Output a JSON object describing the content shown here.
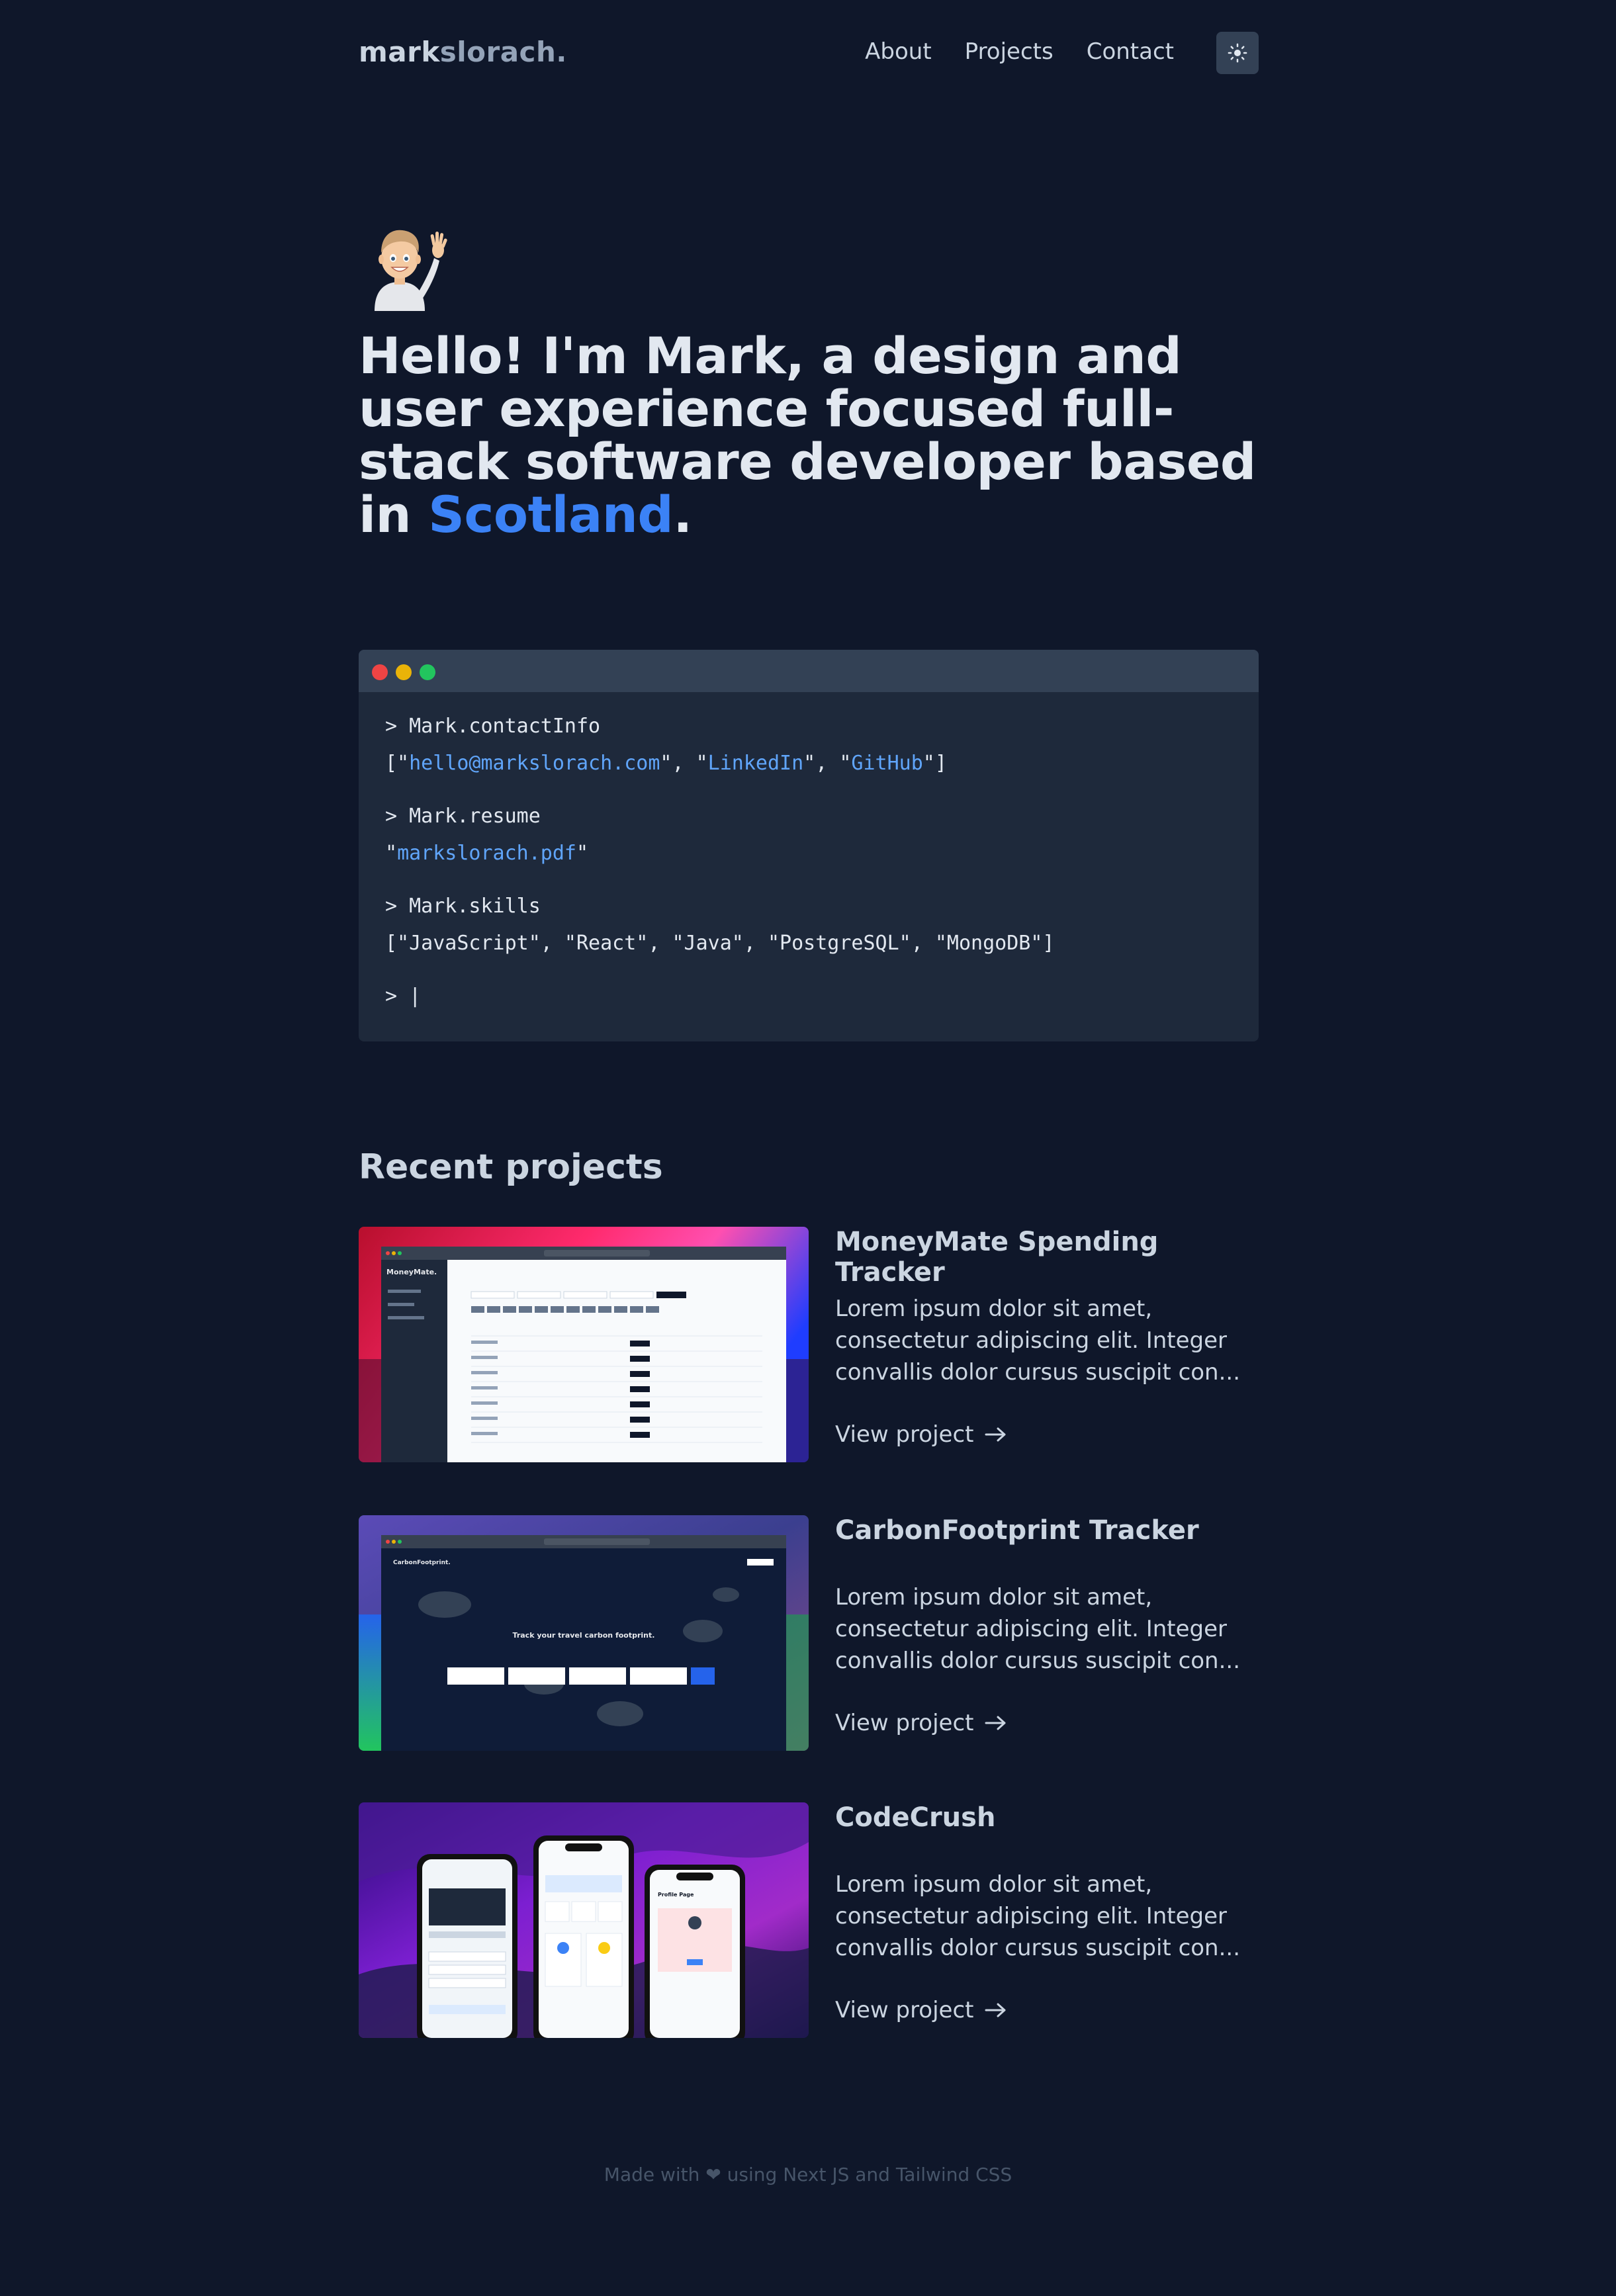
{
  "header": {
    "logo_part1": "mark",
    "logo_part2": "slorach.",
    "nav": [
      "About",
      "Projects",
      "Contact"
    ],
    "theme_icon": "sun-icon"
  },
  "hero": {
    "text_before": "Hello! I'm Mark, a design and user experience focused full-stack software developer based in ",
    "highlight": "Scotland",
    "text_after": ".",
    "avatar_icon": "memoji-waving-avatar"
  },
  "terminal": {
    "cmd1": "> Mark.contactInfo",
    "contact": {
      "email": "hello@markslorach.com",
      "linkedin": "LinkedIn",
      "github": "GitHub"
    },
    "cmd2": "> Mark.resume",
    "resume_file": "markslorach.pdf",
    "cmd3": "> Mark.skills",
    "skills_line": "[\"JavaScript\", \"React\", \"Java\", \"PostgreSQL\", \"MongoDB\"]",
    "prompt": "> |"
  },
  "projects_section": {
    "title": "Recent projects",
    "items": [
      {
        "title": "MoneyMate Spending Tracker",
        "desc": "Lorem ipsum dolor sit amet, consectetur adipiscing elit. Integer convallis dolor cursus suscipit con...",
        "link": "View project",
        "thumb_app": "MoneyMate."
      },
      {
        "title": "CarbonFootprint Tracker",
        "desc": "Lorem ipsum dolor sit amet, consectetur adipiscing elit. Integer convallis dolor cursus suscipit con...",
        "link": "View project",
        "thumb_app": "CarbonFootprint.",
        "thumb_heading": "Track your travel carbon footprint."
      },
      {
        "title": "CodeCrush",
        "desc": "Lorem ipsum dolor sit amet, consectetur adipiscing elit. Integer convallis dolor cursus suscipit con...",
        "link": "View project",
        "thumb_screen": "Profile Page"
      }
    ]
  },
  "footer": {
    "text": "Made with ❤ using Next JS and Tailwind CSS"
  },
  "colors": {
    "background": "#0f172a",
    "accent": "#3b82f6",
    "link": "#60a5fa",
    "terminal": "#1e293b"
  }
}
